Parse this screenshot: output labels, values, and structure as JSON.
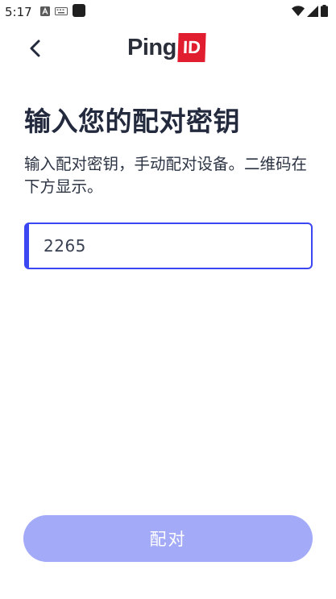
{
  "status_bar": {
    "time": "5:17"
  },
  "header": {
    "back_icon": "chevron-left-icon",
    "logo_ping": "Ping",
    "logo_id": "ID"
  },
  "main": {
    "title": "输入您的配对密钥",
    "description": "输入配对密钥，手动配对设备。二维码在下方显示。",
    "key_field": {
      "value": "2265"
    },
    "pair_button_label": "配对"
  },
  "colors": {
    "accent": "#3b47f1",
    "button_disabled": "#a3aaf7",
    "logo_red": "#e01e2f",
    "text_dark": "#232a3e"
  }
}
